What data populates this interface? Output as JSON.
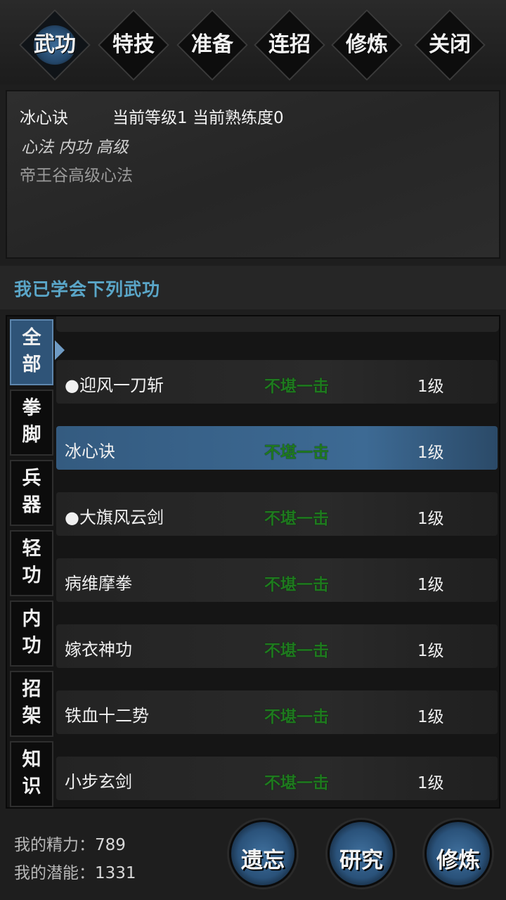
{
  "tabs": [
    "武功",
    "特技",
    "准备",
    "连招",
    "修炼",
    "关闭"
  ],
  "info": {
    "name": "冰心诀",
    "level_text": "当前等级1  当前熟练度0",
    "tags": "心法 内功 高级",
    "desc": "帝王谷高级心法"
  },
  "learned_header": "我已学会下列武功",
  "categories": [
    "全\n部",
    "拳\n脚",
    "兵\n器",
    "轻\n功",
    "内\n功",
    "招\n架",
    "知\n识"
  ],
  "skills": [
    {
      "name": "●迎风一刀斩",
      "state": "不堪一击",
      "level": "1级"
    },
    {
      "name": "冰心诀",
      "state": "不堪一击",
      "level": "1级"
    },
    {
      "name": "●大旗风云剑",
      "state": "不堪一击",
      "level": "1级"
    },
    {
      "name": "病维摩拳",
      "state": "不堪一击",
      "level": "1级"
    },
    {
      "name": "嫁衣神功",
      "state": "不堪一击",
      "level": "1级"
    },
    {
      "name": "铁血十二势",
      "state": "不堪一击",
      "level": "1级"
    },
    {
      "name": "小步玄剑",
      "state": "不堪一击",
      "level": "1级"
    }
  ],
  "stats": {
    "energy_label": "我的精力：",
    "energy": "789",
    "potential_label": "我的潜能：",
    "potential": "1331"
  },
  "buttons": [
    "遗忘",
    "研究",
    "修炼"
  ]
}
